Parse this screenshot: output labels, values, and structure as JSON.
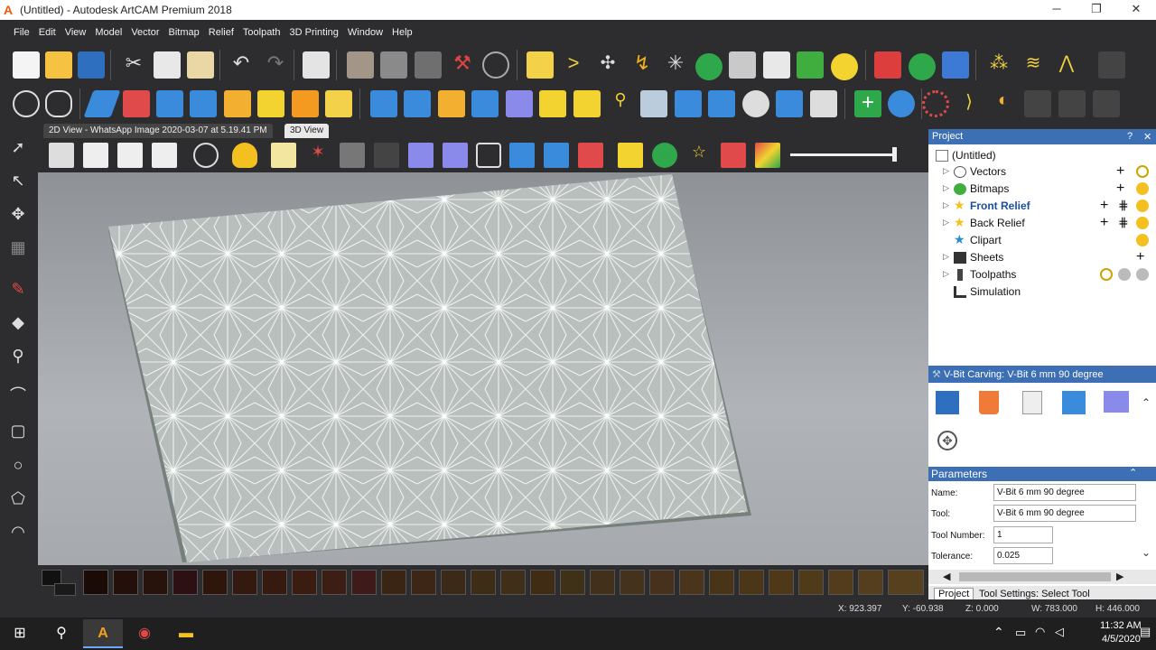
{
  "window": {
    "title": "(Untitled) - Autodesk ArtCAM Premium 2018",
    "logo": "A",
    "minimize": "─",
    "maximize": "❐",
    "close": "✕"
  },
  "menu": [
    "File",
    "Edit",
    "View",
    "Model",
    "Vector",
    "Bitmap",
    "Relief",
    "Toolpath",
    "3D Printing",
    "Window",
    "Help"
  ],
  "tabs": {
    "view2d": "2D View - WhatsApp Image 2020-03-07 at 5.19.41 PM",
    "view3d": "3D View"
  },
  "project": {
    "header": "Project",
    "help": "?",
    "close": "✕",
    "root": "(Untitled)",
    "items": [
      {
        "label": "Vectors",
        "icon": "vector-icon"
      },
      {
        "label": "Bitmaps",
        "icon": "bitmap-icon"
      },
      {
        "label": "Front Relief",
        "icon": "star-icon"
      },
      {
        "label": "Back Relief",
        "icon": "star-icon"
      },
      {
        "label": "Clipart",
        "icon": "star-blue-icon"
      },
      {
        "label": "Sheets",
        "icon": "sheets-icon"
      },
      {
        "label": "Toolpaths",
        "icon": "toolpath-icon"
      },
      {
        "label": "Simulation",
        "icon": "simulation-icon"
      }
    ]
  },
  "vbit": {
    "header": "V-Bit Carving: V-Bit 6 mm 90 degree"
  },
  "parameters": {
    "header": "Parameters",
    "rows": [
      {
        "label": "Name:",
        "value": "V-Bit 6 mm 90 degree"
      },
      {
        "label": "Tool:",
        "value": "V-Bit 6 mm 90 degree"
      },
      {
        "label": "Tool Number:",
        "value": "1"
      },
      {
        "label": "Tolerance:",
        "value": "0.025"
      }
    ]
  },
  "panel_tabs": [
    "Project",
    "Tool Settings: Select Tool"
  ],
  "status": {
    "x": "X: 923.397",
    "y": "Y: -60.938",
    "z": "Z: 0.000",
    "w": "W: 783.000",
    "h": "H: 446.000"
  },
  "taskbar": {
    "time": "11:32 AM",
    "date": "4/5/2020"
  },
  "colors": {
    "accent": "#3c6fb4",
    "bg": "#2d2d30"
  }
}
